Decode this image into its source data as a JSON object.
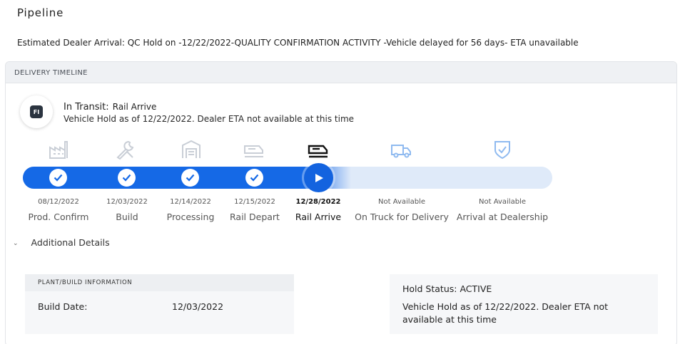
{
  "page": {
    "title": "Pipeline",
    "eta_message": "Estimated Dealer Arrival: QC Hold on -12/22/2022-QUALITY CONFIRMATION ACTIVITY -Vehicle delayed for 56 days- ETA unavailable"
  },
  "timeline": {
    "header": "DELIVERY TIMELINE",
    "avatar_text": "FI",
    "status_label": "In Transit:",
    "status_value": "Rail Arrive",
    "status_note": "Vehicle Hold as of 12/22/2022. Dealer ETA not available at this time",
    "progress_fraction": 0.6,
    "accent_color": "#1569e6",
    "track_color": "#dfeaf9",
    "steps": [
      {
        "icon": "factory-icon",
        "date": "08/12/2022",
        "name": "Prod. Confirm",
        "state": "complete"
      },
      {
        "icon": "wrench-icon",
        "date": "12/03/2022",
        "name": "Build",
        "state": "complete"
      },
      {
        "icon": "processing-icon",
        "date": "12/14/2022",
        "name": "Processing",
        "state": "complete"
      },
      {
        "icon": "rail-icon",
        "date": "12/15/2022",
        "name": "Rail Depart",
        "state": "complete"
      },
      {
        "icon": "rail-icon",
        "date": "12/28/2022",
        "name": "Rail Arrive",
        "state": "current"
      },
      {
        "icon": "truck-icon",
        "date": "Not Available",
        "name": "On Truck for Delivery",
        "state": "pending"
      },
      {
        "icon": "shield-check-icon",
        "date": "Not Available",
        "name": "Arrival at Dealership",
        "state": "pending"
      }
    ]
  },
  "details": {
    "toggle_label": "Additional Details",
    "plant": {
      "header": "PLANT/BUILD INFORMATION",
      "build_date_label": "Build Date:",
      "build_date_value": "12/03/2022"
    },
    "hold": {
      "status": "Hold Status: ACTIVE",
      "note": "Vehicle Hold as of 12/22/2022. Dealer ETA not available at this time"
    }
  }
}
